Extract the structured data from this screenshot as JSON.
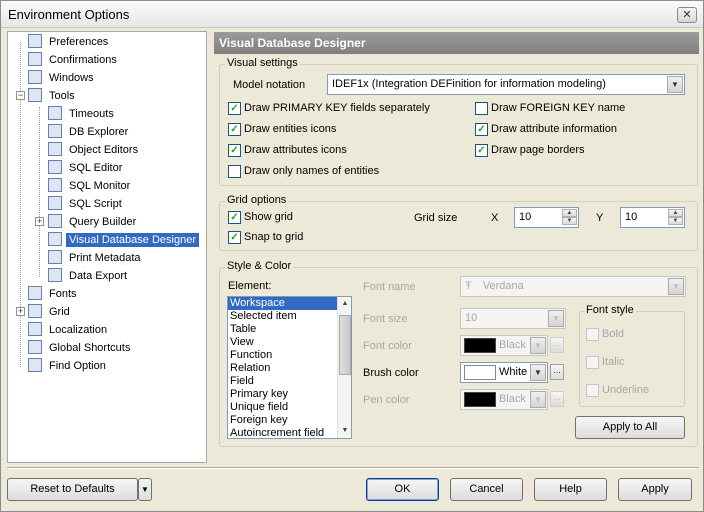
{
  "window": {
    "title": "Environment Options",
    "close_symbol": "✕"
  },
  "tree": {
    "items": [
      {
        "label": "Preferences"
      },
      {
        "label": "Confirmations"
      },
      {
        "label": "Windows"
      },
      {
        "label": "Tools"
      },
      {
        "label": "Timeouts"
      },
      {
        "label": "DB Explorer"
      },
      {
        "label": "Object Editors"
      },
      {
        "label": "SQL Editor"
      },
      {
        "label": "SQL Monitor"
      },
      {
        "label": "SQL Script"
      },
      {
        "label": "Query Builder"
      },
      {
        "label": "Visual Database Designer",
        "selected": true
      },
      {
        "label": "Print Metadata"
      },
      {
        "label": "Data Export"
      },
      {
        "label": "Fonts"
      },
      {
        "label": "Grid"
      },
      {
        "label": "Localization"
      },
      {
        "label": "Global Shortcuts"
      },
      {
        "label": "Find Option"
      }
    ]
  },
  "panel": {
    "title": "Visual Database Designer"
  },
  "visual_settings": {
    "group_label": "Visual settings",
    "model_notation_label": "Model notation",
    "model_notation_value": "IDEF1x (Integration DEFinition for information modeling)",
    "checks": {
      "draw_pk": {
        "label": "Draw PRIMARY KEY fields separately",
        "checked": true
      },
      "draw_entities_icons": {
        "label": "Draw entities icons",
        "checked": true
      },
      "draw_attributes_icons": {
        "label": "Draw attributes icons",
        "checked": true
      },
      "draw_only_names": {
        "label": "Draw only names of entities",
        "checked": false
      },
      "draw_fk_name": {
        "label": "Draw FOREIGN KEY name",
        "checked": false
      },
      "draw_attr_info": {
        "label": "Draw attribute information",
        "checked": true
      },
      "draw_page_borders": {
        "label": "Draw page borders",
        "checked": true
      }
    }
  },
  "grid_options": {
    "group_label": "Grid options",
    "show_grid": {
      "label": "Show grid",
      "checked": true
    },
    "snap_to_grid": {
      "label": "Snap to grid",
      "checked": true
    },
    "grid_size_label": "Grid size",
    "x_label": "X",
    "x_value": "10",
    "y_label": "Y",
    "y_value": "10"
  },
  "style_color": {
    "group_label": "Style & Color",
    "element_label": "Element:",
    "elements": [
      "Workspace",
      "Selected item",
      "Table",
      "View",
      "Function",
      "Relation",
      "Field",
      "Primary key",
      "Unique field",
      "Foreign key",
      "Autoincrement field"
    ],
    "selected_element": "Workspace",
    "font_name_label": "Font name",
    "font_name_value": "Verdana",
    "font_size_label": "Font size",
    "font_size_value": "10",
    "font_color_label": "Font color",
    "font_color_value": "Black",
    "brush_color_label": "Brush color",
    "brush_color_value": "White",
    "pen_color_label": "Pen color",
    "pen_color_value": "Black",
    "font_style_label": "Font style",
    "bold_label": "Bold",
    "italic_label": "Italic",
    "underline_label": "Underline",
    "apply_all_label": "Apply to All",
    "more_symbol": "..."
  },
  "footer": {
    "reset_label": "Reset to Defaults",
    "ok_label": "OK",
    "cancel_label": "Cancel",
    "help_label": "Help",
    "apply_label": "Apply"
  },
  "colors": {
    "selection": "#316ac5",
    "header_gradient_top": "#9c9c9c",
    "check_mark": "#21a121",
    "dialog_bg": "#ece9d8"
  }
}
